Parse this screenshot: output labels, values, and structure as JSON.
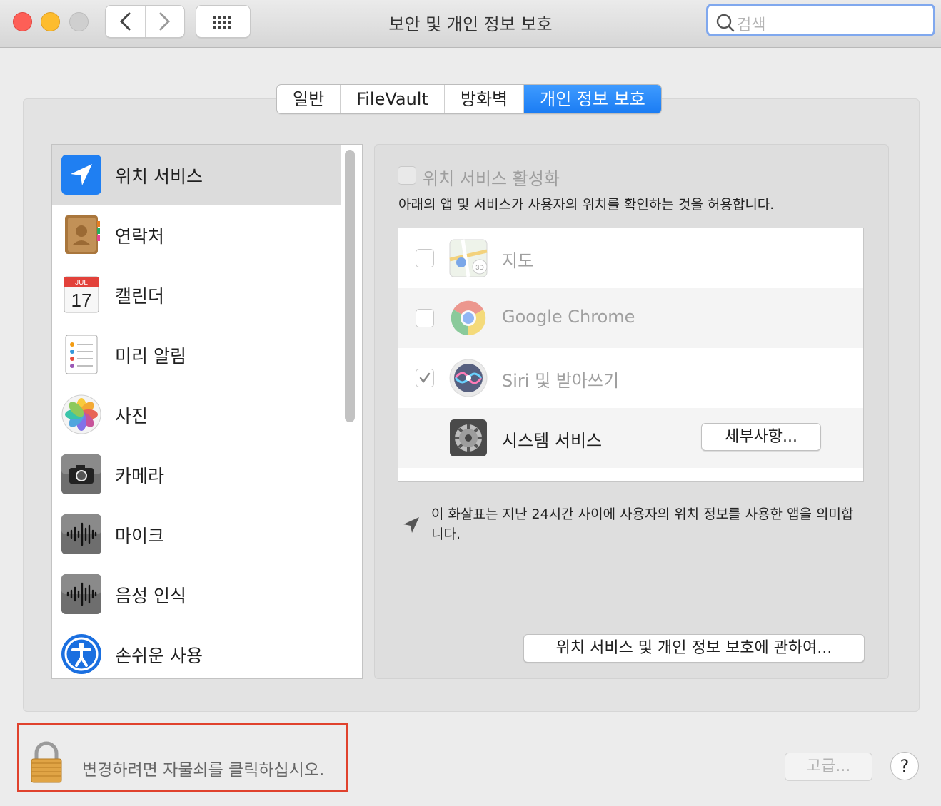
{
  "window": {
    "title": "보안 및 개인 정보 보호"
  },
  "toolbar": {
    "back_icon": "chevron-left-icon",
    "forward_icon": "chevron-right-icon",
    "grid_icon": "grid-icon"
  },
  "search": {
    "placeholder": "검색"
  },
  "tabs": [
    {
      "label": "일반",
      "active": false
    },
    {
      "label": "FileVault",
      "active": false
    },
    {
      "label": "방화벽",
      "active": false
    },
    {
      "label": "개인 정보 보호",
      "active": true
    }
  ],
  "sidebar": {
    "items": [
      {
        "label": "위치 서비스",
        "icon": "location-arrow-icon",
        "selected": true
      },
      {
        "label": "연락처",
        "icon": "contacts-icon"
      },
      {
        "label": "캘린더",
        "icon": "calendar-icon",
        "month": "JUL",
        "day": "17"
      },
      {
        "label": "미리 알림",
        "icon": "reminders-icon"
      },
      {
        "label": "사진",
        "icon": "photos-icon"
      },
      {
        "label": "카메라",
        "icon": "camera-icon"
      },
      {
        "label": "마이크",
        "icon": "microphone-icon"
      },
      {
        "label": "음성 인식",
        "icon": "speech-recognition-icon"
      },
      {
        "label": "손쉬운 사용",
        "icon": "accessibility-icon"
      }
    ]
  },
  "location": {
    "enable_label": "위치 서비스 활성화",
    "enable_checked": false,
    "description": "아래의 앱 및 서비스가 사용자의 위치를 확인하는 것을 허용합니다.",
    "apps": [
      {
        "label": "지도",
        "icon": "maps-icon",
        "checked": false
      },
      {
        "label": "Google Chrome",
        "icon": "chrome-icon",
        "checked": false
      },
      {
        "label": "Siri 및 받아쓰기",
        "icon": "siri-icon",
        "checked": true
      },
      {
        "label": "시스템 서비스",
        "icon": "system-gear-icon",
        "details_button": "세부사항..."
      }
    ],
    "note": "이 화살표는 지난 24시간 사이에 사용자의 위치 정보를 사용한 앱을 의미합니다.",
    "about_button": "위치 서비스 및 개인 정보 보호에 관하여..."
  },
  "footer": {
    "lock_text": "변경하려면 자물쇠를 클릭하십시오.",
    "advanced_button": "고급...",
    "help_button": "?"
  }
}
